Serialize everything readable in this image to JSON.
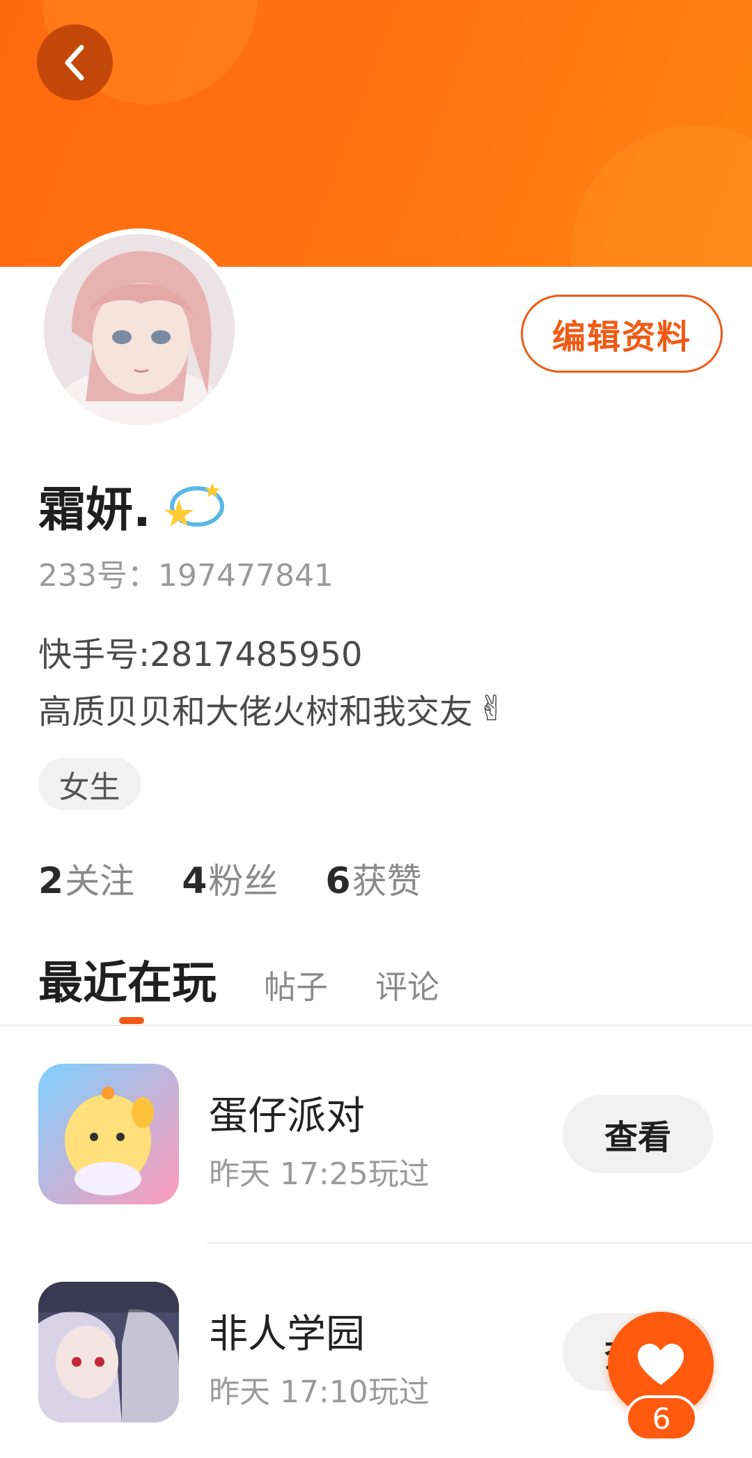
{
  "profile": {
    "edit_label": "编辑资料",
    "name": "霜妍.",
    "uid_text": "233号：197477841",
    "bio_line1": "快手号:2817485950",
    "bio_line2": "高质贝贝和大佬火树和我交友",
    "bio_emoji": "✌",
    "gender": "女生"
  },
  "stats": [
    {
      "num": "2",
      "label": "关注"
    },
    {
      "num": "4",
      "label": "粉丝"
    },
    {
      "num": "6",
      "label": "获赞"
    }
  ],
  "tabs": [
    "最近在玩",
    "帖子",
    "评论"
  ],
  "games": [
    {
      "name": "蛋仔派对",
      "played": "昨天 17:25玩过",
      "action": "查看",
      "icon": "eggy-party-icon"
    },
    {
      "name": "非人学园",
      "played": "昨天 17:10玩过",
      "action": "查看",
      "icon": "fei-ren-xue-yuan-icon"
    }
  ],
  "like": {
    "count": "6"
  },
  "colors": {
    "accent": "#f05a14",
    "banner": "#ff7411"
  }
}
